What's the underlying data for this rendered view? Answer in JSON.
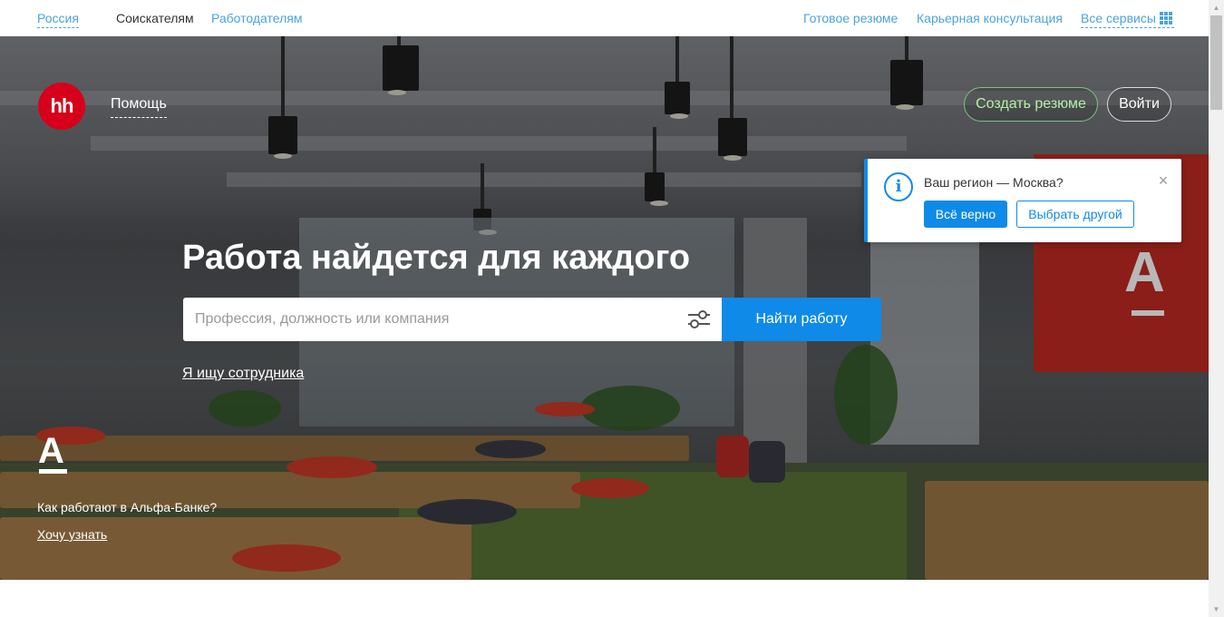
{
  "topbar": {
    "region": "Россия",
    "seekers": "Соискателям",
    "employers": "Работодателям",
    "ready_resume": "Готовое резюме",
    "career_consult": "Карьерная консультация",
    "all_services": "Все сервисы"
  },
  "header": {
    "logo_text": "hh",
    "help": "Помощь",
    "create_resume": "Создать резюме",
    "login": "Войти"
  },
  "hero": {
    "headline": "Работа найдется для каждого",
    "search_placeholder": "Профессия, должность или компания",
    "search_value": "",
    "find_button": "Найти работу",
    "employer_link": "Я ищу сотрудника"
  },
  "promo": {
    "brand_letter": "А",
    "question": "Как работают в Альфа-Банке?",
    "more": "Хочу узнать"
  },
  "region_popup": {
    "info_glyph": "i",
    "question": "Ваш регион — Москва?",
    "confirm": "Всё верно",
    "choose_other": "Выбрать другой",
    "close_glyph": "×"
  },
  "icons": {
    "filter": "sliders-icon",
    "grid": "grid-icon",
    "info": "info-icon",
    "close": "close-icon"
  },
  "colors": {
    "accent": "#0f8ae9",
    "link": "#4aa3df",
    "brand_red": "#d6001c",
    "create_resume_text": "#b5f0a7"
  }
}
